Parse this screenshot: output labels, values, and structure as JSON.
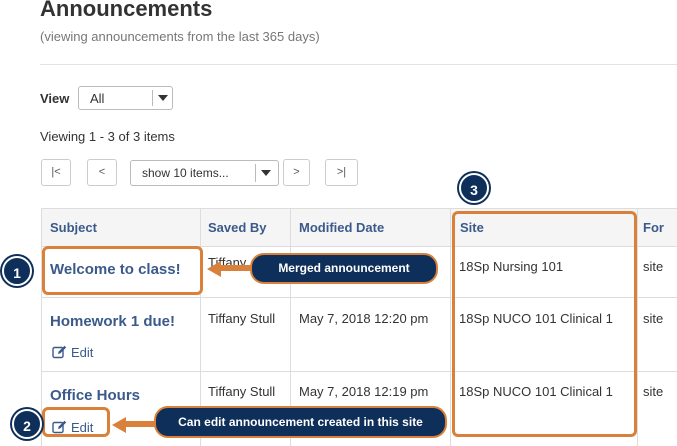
{
  "page": {
    "title": "Announcements",
    "subtitle": "(viewing announcements from the last 365 days)"
  },
  "view": {
    "label": "View",
    "selected": "All"
  },
  "viewing_text": "Viewing 1 - 3 of 3 items",
  "pager": {
    "first": "|<",
    "prev": "<",
    "page_size": "show 10 items...",
    "next": ">",
    "last": ">|"
  },
  "table": {
    "headers": [
      "Subject",
      "Saved By",
      "Modified Date",
      "Site",
      "For"
    ],
    "rows": [
      {
        "subject": "Welcome to class!",
        "saved_by": "Tiffany",
        "modified": "",
        "site": "18Sp Nursing 101",
        "for": "site",
        "edit": ""
      },
      {
        "subject": "Homework 1 due!",
        "saved_by": "Tiffany Stull",
        "modified": "May 7, 2018 12:20 pm",
        "site": "18Sp NUCO 101 Clinical 1",
        "for": "site",
        "edit": "Edit"
      },
      {
        "subject": "Office Hours",
        "saved_by": "Tiffany Stull",
        "modified": "May 7, 2018 12:19 pm",
        "site": "18Sp NUCO 101 Clinical 1",
        "for": "site",
        "edit": "Edit"
      }
    ]
  },
  "callouts": {
    "merged": "Merged announcement",
    "can_edit": "Can edit announcement created in this site",
    "n1": "1",
    "n2": "2",
    "n3": "3"
  },
  "colors": {
    "accent": "#d9813a",
    "callout_bg": "#0e2f5a",
    "link": "#3b5a8a"
  },
  "icons": {
    "edit": "pencil-square-icon",
    "caret": "caret-down-icon"
  }
}
